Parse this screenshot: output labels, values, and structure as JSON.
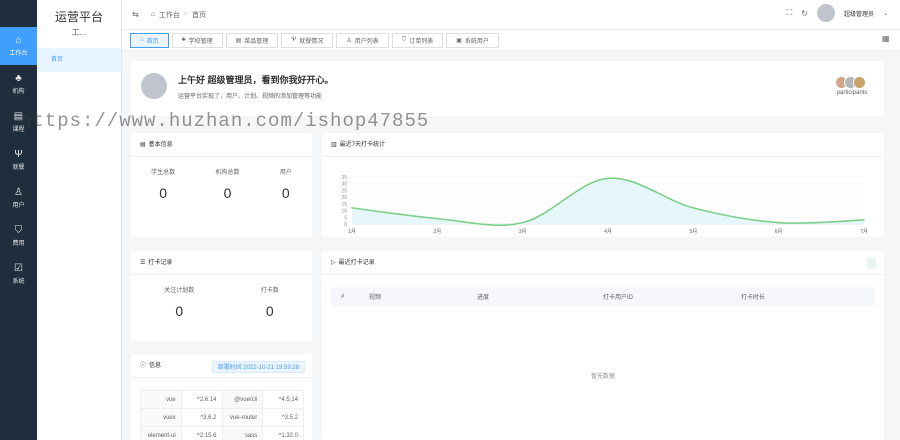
{
  "rail": [
    {
      "label": "工作台",
      "icon": "home-icon",
      "glyph": "⌂",
      "active": true
    },
    {
      "label": "机构",
      "icon": "org-icon",
      "glyph": "♣",
      "active": false
    },
    {
      "label": "课程",
      "icon": "course-icon",
      "glyph": "▤",
      "active": false
    },
    {
      "label": "就餐",
      "icon": "dining-icon",
      "glyph": "Ψ",
      "active": false
    },
    {
      "label": "用户",
      "icon": "user-icon",
      "glyph": "♙",
      "active": false
    },
    {
      "label": "费用",
      "icon": "fee-icon",
      "glyph": "⛉",
      "active": false
    },
    {
      "label": "系统",
      "icon": "system-icon",
      "glyph": "☑",
      "active": false
    }
  ],
  "submenu": {
    "title": "运营平台",
    "subtitle": "工...",
    "item": "首页"
  },
  "topbar": {
    "collapse_icon": "menu-fold-icon",
    "crumb_home": "工作台",
    "crumb_sep": ">",
    "crumb_current": "首页",
    "user_name": "超级管理员"
  },
  "tags": [
    {
      "label": "首页",
      "glyph": "⌂",
      "active": true
    },
    {
      "label": "学校管理",
      "glyph": "♣",
      "active": false
    },
    {
      "label": "菜品管理",
      "glyph": "▤",
      "active": false
    },
    {
      "label": "就餐情况",
      "glyph": "Ψ",
      "active": false
    },
    {
      "label": "用户列表",
      "glyph": "♙",
      "active": false
    },
    {
      "label": "订单列表",
      "glyph": "⛉",
      "active": false
    },
    {
      "label": "系统用户",
      "glyph": "▣",
      "active": false
    }
  ],
  "welcome": {
    "greeting": "上午好 超级管理员，看到你我好开心。",
    "desc": "运营平台实现了，用户、计划、视频的添加管理等功能",
    "participants_label": "participants",
    "participant_colors": [
      "#d4a48a",
      "#b7b7b7",
      "#c8a26a"
    ]
  },
  "basic": {
    "title": "基本信息",
    "stats": [
      {
        "label": "学生总数",
        "value": "0"
      },
      {
        "label": "机构总数",
        "value": "0"
      },
      {
        "label": "用户",
        "value": "0"
      }
    ]
  },
  "punch": {
    "title": "打卡记录",
    "stats": [
      {
        "label": "关注计划数",
        "value": "0"
      },
      {
        "label": "打卡数",
        "value": "0"
      }
    ]
  },
  "recent": {
    "title": "最近打卡记录",
    "columns": [
      "#",
      "视频",
      "进度",
      "打卡用户ID",
      "打卡时长"
    ],
    "empty_text": "暂无数据"
  },
  "info": {
    "title": "信息",
    "time": "部署时间:2022-10-21 19:59:28",
    "rows": [
      [
        "vue",
        "^2.6.14",
        "@vue/cli",
        "^4.5.14"
      ],
      [
        "vuex",
        "^3.6.2",
        "vue-router",
        "^3.5.2"
      ],
      [
        "element-ui",
        "^2.15.6",
        "sass",
        "^1.32.0"
      ]
    ]
  },
  "watermark": "https://www.huzhan.com/ishop47855",
  "chart_data": {
    "type": "area",
    "title": "最近7天打卡统计",
    "categories": [
      "1月",
      "2月",
      "3月",
      "4月",
      "5月",
      "6月",
      "7月"
    ],
    "series": [
      {
        "values": [
          12,
          4,
          1,
          34,
          12,
          1,
          3
        ]
      }
    ],
    "ylim": [
      0,
      35
    ],
    "yticks": [
      "35",
      "30",
      "25",
      "20",
      "15",
      "10",
      "5",
      "0"
    ],
    "line_color": "#7ccf8a",
    "area_color": "#e6f7fb"
  }
}
